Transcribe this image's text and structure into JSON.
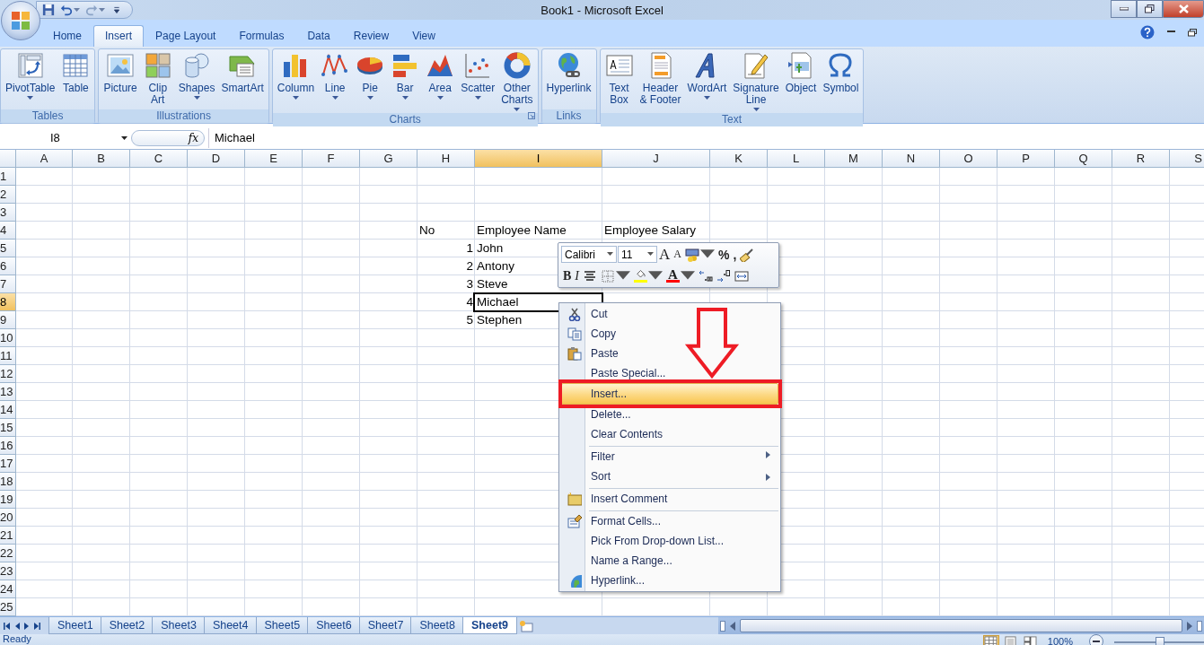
{
  "window": {
    "title": "Book1 - Microsoft Excel"
  },
  "quick_access": [
    {
      "kind": "save",
      "dropdown": false
    },
    {
      "kind": "undo",
      "dropdown": true
    },
    {
      "kind": "redo",
      "dropdown": true
    },
    {
      "kind": "customize",
      "dropdown": false
    }
  ],
  "ribbon_tabs": [
    {
      "label": "Home",
      "selected": false
    },
    {
      "label": "Insert",
      "selected": true
    },
    {
      "label": "Page Layout",
      "selected": false
    },
    {
      "label": "Formulas",
      "selected": false
    },
    {
      "label": "Data",
      "selected": false
    },
    {
      "label": "Review",
      "selected": false
    },
    {
      "label": "View",
      "selected": false
    }
  ],
  "ribbon_groups": [
    {
      "label": "Tables",
      "launcher": false,
      "commands": [
        {
          "label": "PivotTable",
          "kind": "pivottable",
          "dropdown": true
        },
        {
          "label": "Table",
          "kind": "table",
          "dropdown": false
        }
      ]
    },
    {
      "label": "Illustrations",
      "launcher": false,
      "commands": [
        {
          "label": "Picture",
          "kind": "picture",
          "dropdown": false
        },
        {
          "label": "Clip\nArt",
          "kind": "clipart",
          "dropdown": false
        },
        {
          "label": "Shapes",
          "kind": "shapes",
          "dropdown": true
        },
        {
          "label": "SmartArt",
          "kind": "smartart",
          "dropdown": false
        }
      ]
    },
    {
      "label": "Charts",
      "launcher": true,
      "commands": [
        {
          "label": "Column",
          "kind": "column",
          "dropdown": true
        },
        {
          "label": "Line",
          "kind": "line",
          "dropdown": true
        },
        {
          "label": "Pie",
          "kind": "pie",
          "dropdown": true
        },
        {
          "label": "Bar",
          "kind": "bar",
          "dropdown": true
        },
        {
          "label": "Area",
          "kind": "area",
          "dropdown": true
        },
        {
          "label": "Scatter",
          "kind": "scatter",
          "dropdown": true
        },
        {
          "label": "Other\nCharts",
          "kind": "donut",
          "dropdown": true
        }
      ]
    },
    {
      "label": "Links",
      "launcher": false,
      "commands": [
        {
          "label": "Hyperlink",
          "kind": "globe",
          "dropdown": false
        }
      ]
    },
    {
      "label": "Text",
      "launcher": false,
      "commands": [
        {
          "label": "Text\nBox",
          "kind": "textbox",
          "dropdown": false
        },
        {
          "label": "Header\n& Footer",
          "kind": "header",
          "dropdown": false
        },
        {
          "label": "WordArt",
          "kind": "wordart",
          "dropdown": true
        },
        {
          "label": "Signature\nLine",
          "kind": "signature",
          "dropdown": true
        },
        {
          "label": "Object",
          "kind": "object",
          "dropdown": false
        },
        {
          "label": "Symbol",
          "kind": "symbol",
          "dropdown": false
        }
      ]
    }
  ],
  "formula_bar": {
    "name_box": "I8",
    "function_label": "fx",
    "formula": "Michael"
  },
  "columns": [
    {
      "label": "A",
      "selected": false
    },
    {
      "label": "B",
      "selected": false
    },
    {
      "label": "C",
      "selected": false
    },
    {
      "label": "D",
      "selected": false
    },
    {
      "label": "E",
      "selected": false
    },
    {
      "label": "F",
      "selected": false
    },
    {
      "label": "G",
      "selected": false
    },
    {
      "label": "H",
      "selected": false
    },
    {
      "label": "I",
      "selected": true
    },
    {
      "label": "J",
      "selected": false
    },
    {
      "label": "K",
      "selected": false
    },
    {
      "label": "L",
      "selected": false
    },
    {
      "label": "M",
      "selected": false
    },
    {
      "label": "N",
      "selected": false
    },
    {
      "label": "O",
      "selected": false
    },
    {
      "label": "P",
      "selected": false
    },
    {
      "label": "Q",
      "selected": false
    },
    {
      "label": "R",
      "selected": false
    },
    {
      "label": "S",
      "selected": false
    }
  ],
  "rows": [
    {
      "label": "1",
      "selected": false
    },
    {
      "label": "2",
      "selected": false
    },
    {
      "label": "3",
      "selected": false
    },
    {
      "label": "4",
      "selected": false
    },
    {
      "label": "5",
      "selected": false
    },
    {
      "label": "6",
      "selected": false
    },
    {
      "label": "7",
      "selected": false
    },
    {
      "label": "8",
      "selected": true
    },
    {
      "label": "9",
      "selected": false
    },
    {
      "label": "10",
      "selected": false
    },
    {
      "label": "11",
      "selected": false
    },
    {
      "label": "12",
      "selected": false
    },
    {
      "label": "13",
      "selected": false
    },
    {
      "label": "14",
      "selected": false
    },
    {
      "label": "15",
      "selected": false
    },
    {
      "label": "16",
      "selected": false
    },
    {
      "label": "17",
      "selected": false
    },
    {
      "label": "18",
      "selected": false
    },
    {
      "label": "19",
      "selected": false
    },
    {
      "label": "20",
      "selected": false
    },
    {
      "label": "21",
      "selected": false
    },
    {
      "label": "22",
      "selected": false
    },
    {
      "label": "23",
      "selected": false
    },
    {
      "label": "24",
      "selected": false
    },
    {
      "label": "25",
      "selected": false
    }
  ],
  "table": {
    "headers": [
      "No",
      "Employee Name",
      "Employee Salary"
    ],
    "rows": [
      {
        "no": "1",
        "name": "John",
        "selected": false
      },
      {
        "no": "2",
        "name": "Antony",
        "selected": false
      },
      {
        "no": "3",
        "name": "Steve",
        "selected": false
      },
      {
        "no": "4",
        "name": "Michael",
        "selected": true
      },
      {
        "no": "5",
        "name": "Stephen",
        "selected": false
      }
    ]
  },
  "mini_toolbar": {
    "font": "Calibri",
    "size": "11",
    "rows": [
      [
        {
          "kind": "grow_font",
          "glyph": "A",
          "dropdown": false
        },
        {
          "kind": "shrink_font",
          "glyph": "A",
          "dropdown": false
        },
        {
          "kind": "accounting",
          "dropdown": true
        },
        {
          "kind": "percent",
          "glyph": "%",
          "dropdown": false
        },
        {
          "kind": "comma",
          "glyph": ",",
          "dropdown": false
        },
        {
          "kind": "painter",
          "dropdown": false
        }
      ],
      [
        {
          "kind": "bold",
          "glyph": "B",
          "dropdown": false
        },
        {
          "kind": "italic",
          "glyph": "I",
          "dropdown": false
        },
        {
          "kind": "center",
          "dropdown": false
        },
        {
          "kind": "borders",
          "dropdown": true
        },
        {
          "kind": "fill",
          "color": "#ffff00",
          "dropdown": true
        },
        {
          "kind": "font_color",
          "glyph": "A",
          "color": "#ff0000",
          "dropdown": true
        },
        {
          "kind": "increase_decimal",
          "dropdown": false
        },
        {
          "kind": "decrease_decimal",
          "dropdown": false
        },
        {
          "kind": "merge",
          "dropdown": false
        }
      ]
    ]
  },
  "context_menu": [
    {
      "label": "Cut",
      "kind": "scissors",
      "selected": false,
      "submenu": false,
      "separator_before": false
    },
    {
      "label": "Copy",
      "kind": "copy",
      "selected": false,
      "submenu": false,
      "separator_before": false
    },
    {
      "label": "Paste",
      "kind": "paste",
      "selected": false,
      "submenu": false,
      "separator_before": false
    },
    {
      "label": "Paste Special...",
      "kind": "plain",
      "selected": false,
      "submenu": false,
      "separator_before": false
    },
    {
      "label": "Insert...",
      "kind": "plain",
      "selected": true,
      "submenu": false,
      "separator_before": false
    },
    {
      "label": "Delete...",
      "kind": "plain",
      "selected": false,
      "submenu": false,
      "separator_before": false
    },
    {
      "label": "Clear Contents",
      "kind": "plain",
      "selected": false,
      "submenu": false,
      "separator_before": false
    },
    {
      "label": "Filter",
      "kind": "plain",
      "selected": false,
      "submenu": true,
      "separator_before": true
    },
    {
      "label": "Sort",
      "kind": "plain",
      "selected": false,
      "submenu": true,
      "separator_before": false
    },
    {
      "label": "Insert Comment",
      "kind": "comment",
      "selected": false,
      "submenu": false,
      "separator_before": true
    },
    {
      "label": "Format Cells...",
      "kind": "format",
      "selected": false,
      "submenu": false,
      "separator_before": true
    },
    {
      "label": "Pick From Drop-down List...",
      "kind": "plain",
      "selected": false,
      "submenu": false,
      "separator_before": false
    },
    {
      "label": "Name a Range...",
      "kind": "plain",
      "selected": false,
      "submenu": false,
      "separator_before": false
    },
    {
      "label": "Hyperlink...",
      "kind": "globe",
      "selected": false,
      "submenu": false,
      "separator_before": false
    }
  ],
  "annotations": [
    {
      "kind": "down_arrow",
      "color": "#ee1c25"
    },
    {
      "kind": "frame",
      "color": "#ee1c25"
    }
  ],
  "sheet_tabs": [
    {
      "label": "Sheet1",
      "selected": false
    },
    {
      "label": "Sheet2",
      "selected": false
    },
    {
      "label": "Sheet3",
      "selected": false
    },
    {
      "label": "Sheet4",
      "selected": false
    },
    {
      "label": "Sheet5",
      "selected": false
    },
    {
      "label": "Sheet6",
      "selected": false
    },
    {
      "label": "Sheet7",
      "selected": false
    },
    {
      "label": "Sheet8",
      "selected": false
    },
    {
      "label": "Sheet9",
      "selected": true
    }
  ],
  "status_bar": {
    "status": "Ready",
    "views": [
      {
        "kind": "normal",
        "selected": true
      },
      {
        "kind": "page_layout",
        "selected": false
      },
      {
        "kind": "page_break",
        "selected": false
      }
    ],
    "zoom_label": "100%",
    "zoom": {
      "level": 0.5
    }
  }
}
